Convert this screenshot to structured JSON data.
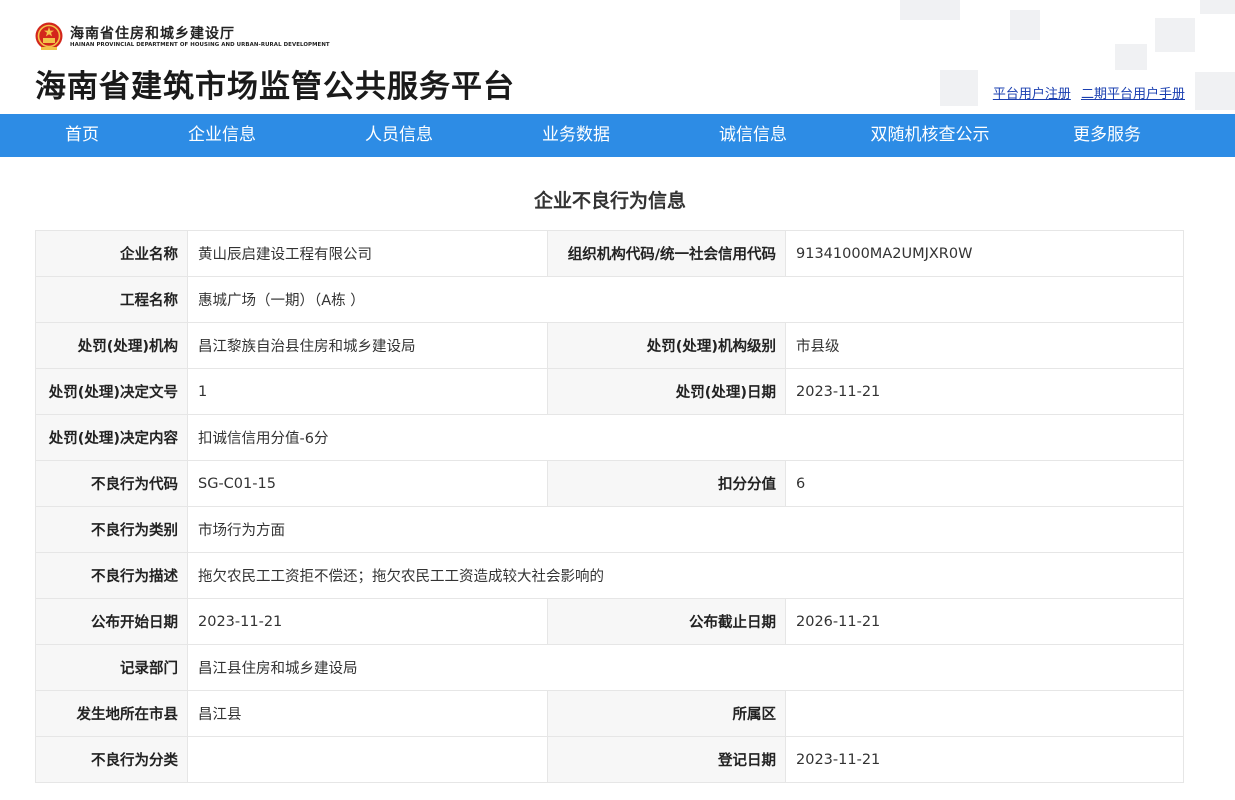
{
  "header": {
    "dept_cn": "海南省住房和城乡建设厅",
    "dept_en": "HAINAN PROVINCIAL DEPARTMENT OF HOUSING AND URBAN-RURAL DEVELOPMENT",
    "site_title": "海南省建筑市场监管公共服务平台",
    "links": [
      "平台用户注册",
      "二期平台用户手册"
    ]
  },
  "nav": [
    "首页",
    "企业信息",
    "人员信息",
    "业务数据",
    "诚信信息",
    "双随机核查公示",
    "更多服务"
  ],
  "page_heading": "企业不良行为信息",
  "table": {
    "rows": [
      [
        "企业名称",
        "黄山辰启建设工程有限公司",
        "组织机构代码/统一社会信用代码",
        "91341000MA2UMJXR0W"
      ],
      [
        "工程名称",
        "惠城广场（一期）（A栋 ）"
      ],
      [
        "处罚(处理)机构",
        "昌江黎族自治县住房和城乡建设局",
        "处罚(处理)机构级别",
        "市县级"
      ],
      [
        "处罚(处理)决定文号",
        "1",
        "处罚(处理)日期",
        "2023-11-21"
      ],
      [
        "处罚(处理)决定内容",
        "扣诚信信用分值-6分"
      ],
      [
        "不良行为代码",
        "SG-C01-15",
        "扣分分值",
        "6"
      ],
      [
        "不良行为类别",
        "市场行为方面"
      ],
      [
        "不良行为描述",
        "拖欠农民工工资拒不偿还；拖欠农民工工资造成较大社会影响的"
      ],
      [
        "公布开始日期",
        "2023-11-21",
        "公布截止日期",
        "2026-11-21"
      ],
      [
        "记录部门",
        "昌江县住房和城乡建设局"
      ],
      [
        "发生地所在市县",
        "昌江县",
        "所属区",
        ""
      ],
      [
        "不良行为分类",
        "",
        "登记日期",
        "2023-11-21"
      ]
    ]
  }
}
